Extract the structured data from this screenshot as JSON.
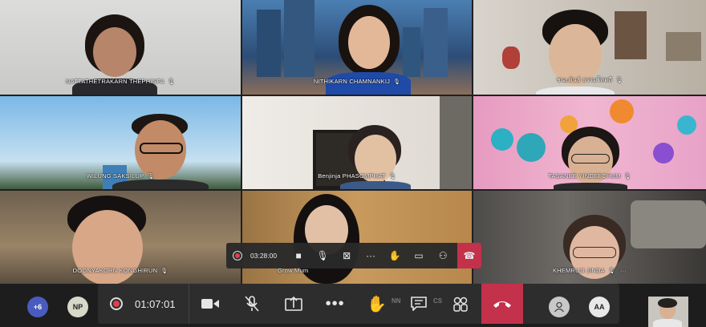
{
  "participants": [
    {
      "name": "NATTATHETRAKARN THEPHINFA",
      "bg": "#d9d9d7"
    },
    {
      "name": "NITHIKARN CHAMNANKIJ",
      "bg": "#3f6a9a"
    },
    {
      "name": "ชนะพันธ์ ธรรมโสตถี",
      "bg": "#c8c2b8"
    },
    {
      "name": "WILUNG SAKSILUP",
      "bg": "#6aa8d6"
    },
    {
      "name": "Benjinja PHASOMPHAT",
      "bg": "#e4e0da"
    },
    {
      "name": "TASANEE YINDEECHUM",
      "bg": "#e6a6c6"
    },
    {
      "name": "DOONYAKORN KONGHIRUN",
      "bg": "#8e7a5e"
    },
    {
      "name": "Grow Mum",
      "bg": "#b78a54"
    },
    {
      "name": "KHEMRUJI JINDA",
      "bg": "#585450"
    }
  ],
  "mini_toolbar": {
    "timer": "03:28:00"
  },
  "bottom_bar": {
    "more_count": "+6",
    "avatar_np": "NP",
    "timer": "01:07:01",
    "avatar_aa": "AA",
    "ghost_nn": "NN",
    "ghost_cs": "CS"
  },
  "colors": {
    "hangup": "#c4314b",
    "record_dot": "#e0404a",
    "more_badge": "#4a5bbf"
  }
}
